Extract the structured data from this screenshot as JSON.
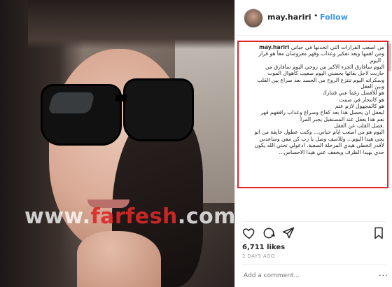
{
  "post": {
    "username": "may.hariri",
    "follow_label": "Follow",
    "separator": "•",
    "likes": "6,711 likes",
    "time_ago": "2 DAYS AGO",
    "comment_placeholder": "Add a comment...",
    "more_label": "...",
    "watermark_part1": "www.",
    "watermark_brand": "farfesh",
    "watermark_part2": ".com"
  },
  "caption": {
    "user": "may.hariri",
    "first_text": "من اصعب القرارات التي اتخذتها في حياتي",
    "lines": [
      "ومن اهمها وبعد تفكير وعذاب وقهر معروضان معاً هو قرار",
      ". اليوم",
      "اليوم سأفارق الجزء الاكبر من روحي اليوم سأفارق من",
      "حاربت لاجل بقائها بحضني اليوم صعيب كأهوال الموت",
      "وسكراته اليوم تنتزع الروح من الجسد بعد صراع بين القلب",
      "وبين العقل",
      "هو للأفضل رغماً عني قتتارك",
      "هو كانتحار في صمت",
      "هو كالمجهول لازم عتم",
      "ليعقل ان يحصل هذا بعد كفاح وصراع وعذاب رافقهم قهر",
      "نعم هذا يعقل عند المستقبل يجبر المرأ",
      ".فصل القلب عن العقل",
      "اليوم هو من اصعب ايام حياتي... وكنت عطول خايفة من انو",
      "يجي هيدا اليوم... وللاسف وصل يا رب كن معي وساعدني",
      "لأقدر اتخطى هيدي المرحلة الصعبة. ادعولي تحتي الله يكون",
      "حدي بهيدا الظرف ويخفف عني هيدا الاحساس..."
    ]
  },
  "icons": {
    "like": "heart-icon",
    "comment": "comment-icon",
    "share": "share-icon",
    "save": "bookmark-icon"
  },
  "colors": {
    "follow": "#3897f0",
    "highlight_border": "#e3262b",
    "text": "#262626",
    "muted": "#999999"
  }
}
